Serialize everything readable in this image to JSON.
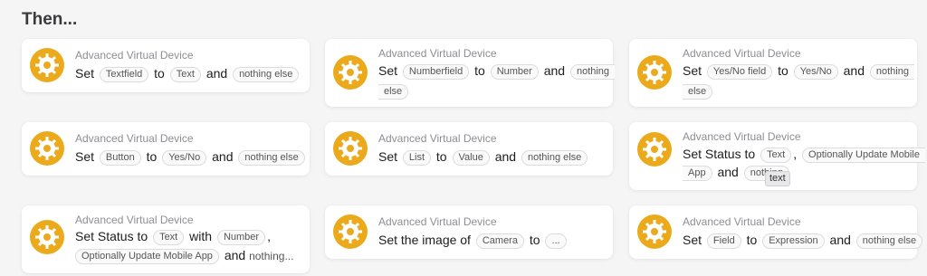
{
  "section_title": "Then...",
  "device_label": "Advanced Virtual Device",
  "cards": [
    {
      "w": [
        "Set"
      ],
      "c": [
        "Textfield"
      ],
      "w2": [
        "to"
      ],
      "c2": [
        "Text"
      ],
      "w3": [
        "and"
      ],
      "c3": [
        "nothing else"
      ]
    },
    {
      "set": "Set",
      "c1": "Numberfield",
      "to": "to",
      "c2": "Number",
      "and": "and",
      "c3a": "nothing",
      "c3b": "else"
    },
    {
      "set": "Set",
      "c1": "Yes/No field",
      "to": "to",
      "c2": "Yes/No",
      "and": "and",
      "c3a": "nothing",
      "c3b": "else"
    },
    {
      "set": "Set",
      "c1": "Button",
      "to": "to",
      "c2": "Yes/No",
      "and": "and",
      "c3": "nothing else"
    },
    {
      "set": "Set",
      "c1": "List",
      "to": "to",
      "c2": "Value",
      "and": "and",
      "c3": "nothing else"
    },
    {
      "set": "Set Status to",
      "c1": "Text",
      "comma": ",",
      "c2": "Optionally Update Mobile",
      "l2a": "App",
      "and": "and",
      "c3": "nothing"
    },
    {
      "set": "Set Status to",
      "c1": "Text",
      "with": "with",
      "c2": "Number",
      "comma": ",",
      "c3": "Optionally Update Mobile App",
      "and": "and",
      "trail": "nothing..."
    },
    {
      "set": "Set the image of",
      "c1": "Camera",
      "to": "to",
      "c2": "..."
    },
    {
      "set": "Set",
      "c1": "Field",
      "to": "to",
      "c2": "Expression",
      "and": "and",
      "c3": "nothing else"
    }
  ],
  "tooltip": "text",
  "colors": {
    "icon": "#eba91c",
    "background": "#f5f5f6",
    "card": "#ffffff"
  },
  "icon_name": "gear-icon"
}
